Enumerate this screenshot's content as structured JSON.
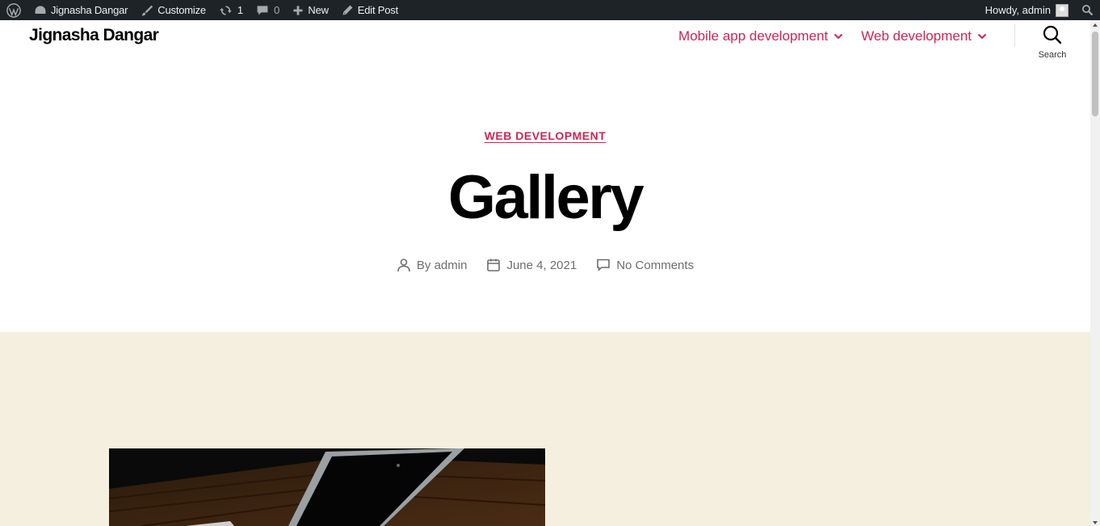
{
  "admin_bar": {
    "site_name": "Jignasha Dangar",
    "customize": "Customize",
    "updates_count": "1",
    "comments_count": "0",
    "new": "New",
    "edit_post": "Edit Post",
    "howdy": "Howdy, admin"
  },
  "header": {
    "site_title": "Jignasha Dangar",
    "menu": [
      {
        "label": "Mobile app development"
      },
      {
        "label": "Web development"
      }
    ],
    "search_label": "Search"
  },
  "post": {
    "category": "WEB DEVELOPMENT",
    "title": "Gallery",
    "author": "By admin",
    "date": "June 4, 2021",
    "comments": "No Comments"
  },
  "colors": {
    "accent": "#cd2653",
    "admin_bar_bg": "#1d2327",
    "content_bg": "#f5efe0"
  }
}
